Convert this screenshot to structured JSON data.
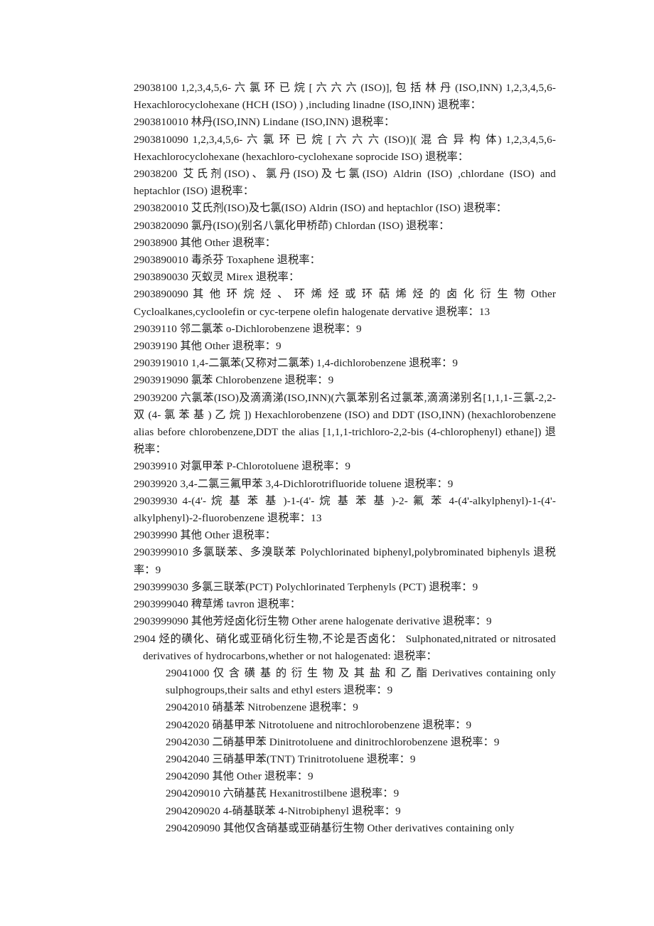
{
  "document": {
    "language_note": "Chinese customs tariff listing — HS codes with Chinese and English descriptions and export tax rebate rate",
    "rebate_label": "退税率",
    "entries": [
      {
        "id": "entry-29038100",
        "indent": "none",
        "text": "29038100  1,2,3,4,5,6- 六 氯 环 已 烷 [ 六 六 六 (ISO)], 包 括 林 丹 (ISO,INN) 1,2,3,4,5,6-Hexachlorocyclohexane (HCH (ISO) ) ,including linadne (ISO,INN)  退税率："
      },
      {
        "id": "entry-2903810010",
        "indent": "none",
        "text": "2903810010  林丹(ISO,INN)  Lindane (ISO,INN)  退税率："
      },
      {
        "id": "entry-2903810090",
        "indent": "none",
        "text": "2903810090   1,2,3,4,5,6- 六 氯 环 已 烷 [ 六 六 六 (ISO)]( 混 合 异 构 体) 1,2,3,4,5,6-Hexachlorocyclohexane (hexachloro-cyclohexane soprocide ISO)  退税率："
      },
      {
        "id": "entry-29038200",
        "indent": "none",
        "text": "29038200  艾氏剂(ISO)、氯丹(ISO)及七氯(ISO) Aldrin (ISO) ,chlordane (ISO) and heptachlor (ISO)  退税率："
      },
      {
        "id": "entry-2903820010",
        "indent": "none",
        "text": "2903820010   艾氏剂(ISO)及七氯(ISO)  Aldrin (ISO) and heptachlor (ISO)  退税率："
      },
      {
        "id": "entry-2903820090",
        "indent": "none",
        "text": "2903820090   氯丹(ISO)(别名八氯化甲桥茚)  Chlordan (ISO)  退税率："
      },
      {
        "id": "entry-29038900",
        "indent": "none",
        "text": "29038900  其他  Other  退税率："
      },
      {
        "id": "entry-2903890010",
        "indent": "none",
        "text": "2903890010   毒杀芬  Toxaphene  退税率："
      },
      {
        "id": "entry-2903890030",
        "indent": "none",
        "text": "2903890030   灭蚁灵  Mirex  退税率："
      },
      {
        "id": "entry-2903890090",
        "indent": "none",
        "text": "2903890090   其 他 环 烷 烃 、 环 烯 烃 或 环 萜 烯 烃 的 卤 化 衍 生 物   Other Cycloalkanes,cycloolefin or cyc-terpene olefin halogenate dervative  退税率：13"
      },
      {
        "id": "entry-29039110",
        "indent": "none",
        "text": "29039110  邻二氯苯  o-Dichlorobenzene  退税率：9"
      },
      {
        "id": "entry-29039190",
        "indent": "none",
        "text": "29039190  其他  Other  退税率：9"
      },
      {
        "id": "entry-2903919010",
        "indent": "none",
        "text": "2903919010  1,4-二氯苯(又称对二氯苯)  1,4-dichlorobenzene  退税率：9"
      },
      {
        "id": "entry-2903919090",
        "indent": "none",
        "text": "2903919090   氯苯  Chlorobenzene  退税率：9"
      },
      {
        "id": "entry-29039200",
        "indent": "none",
        "text": "29039200  六氯苯(ISO)及滴滴涕(ISO,INN)(六氯苯别名过氯苯,滴滴涕别名[1,1,1-三氯-2,2- 双 (4- 氯 苯 基 ) 乙 烷 ])  Hexachlorobenzene (ISO) and DDT (ISO,INN) (hexachlorobenzene alias before chlorobenzene,DDT the alias [1,1,1-trichloro-2,2-bis (4-chlorophenyl) ethane])  退税率："
      },
      {
        "id": "entry-29039910",
        "indent": "none",
        "text": "29039910  对氯甲苯  P-Chlorotoluene  退税率：9"
      },
      {
        "id": "entry-29039920",
        "indent": "none",
        "text": "29039920 3,4-二氯三氟甲苯  3,4-Dichlorotrifluoride toluene  退税率：9"
      },
      {
        "id": "entry-29039930",
        "indent": "none",
        "text": "29039930   4-(4'- 烷 基 苯 基 )-1-(4'- 烷 基 苯 基 )-2- 氟 苯 4-(4'-alkylphenyl)-1-(4'-alkylphenyl)-2-fluorobenzene  退税率：13"
      },
      {
        "id": "entry-29039990",
        "indent": "none",
        "text": "29039990  其他  Other  退税率："
      },
      {
        "id": "entry-2903999010",
        "indent": "none",
        "text": "2903999010   多氯联苯、多溴联苯  Polychlorinated biphenyl,polybrominated biphenyls 退税率：9"
      },
      {
        "id": "entry-2903999030",
        "indent": "none",
        "text": "2903999030   多氯三联苯(PCT)  Polychlorinated Terphenyls (PCT)  退税率：9"
      },
      {
        "id": "entry-2903999040",
        "indent": "none",
        "text": "2903999040   稗草烯  tavron  退税率："
      },
      {
        "id": "entry-2903999090",
        "indent": "none",
        "text": "2903999090   其他芳烃卤化衍生物  Other arene halogenate derivative  退税率：9"
      },
      {
        "id": "entry-2904",
        "indent": "heading",
        "text": " 2904   烃的磺化、硝化或亚硝化衍生物,不论是否卤化：   Sulphonated,nitrated or nitrosated derivatives of hydrocarbons,whether or not halogenated: 退税率："
      },
      {
        "id": "entry-29041000",
        "indent": "indent",
        "text": "29041000  仅 含 磺 基 的 衍 生 物 及 其 盐 和 乙 酯   Derivatives containing only sulphogroups,their salts and ethyl esters  退税率：9"
      },
      {
        "id": "entry-29042010",
        "indent": "indent",
        "text": "29042010  硝基苯  Nitrobenzene  退税率：9"
      },
      {
        "id": "entry-29042020",
        "indent": "indent",
        "text": "29042020  硝基甲苯  Nitrotoluene and nitrochlorobenzene  退税率：9"
      },
      {
        "id": "entry-29042030",
        "indent": "indent",
        "text": "29042030  二硝基甲苯  Dinitrotoluene and dinitrochlorobenzene  退税率：9"
      },
      {
        "id": "entry-29042040",
        "indent": "indent",
        "text": "29042040  三硝基甲苯(TNT) Trinitrotoluene  退税率：9"
      },
      {
        "id": "entry-29042090",
        "indent": "indent",
        "text": "29042090  其他  Other  退税率：9"
      },
      {
        "id": "entry-2904209010",
        "indent": "indent",
        "text": "2904209010  六硝基芪  Hexanitrostilbene  退税率：9"
      },
      {
        "id": "entry-2904209020",
        "indent": "indent",
        "text": "2904209020 4-硝基联苯  4-Nitrobiphenyl  退税率：9"
      },
      {
        "id": "entry-2904209090",
        "indent": "indent",
        "text": "2904209090  其他仅含硝基或亚硝基衍生物  Other derivatives containing only"
      }
    ]
  }
}
